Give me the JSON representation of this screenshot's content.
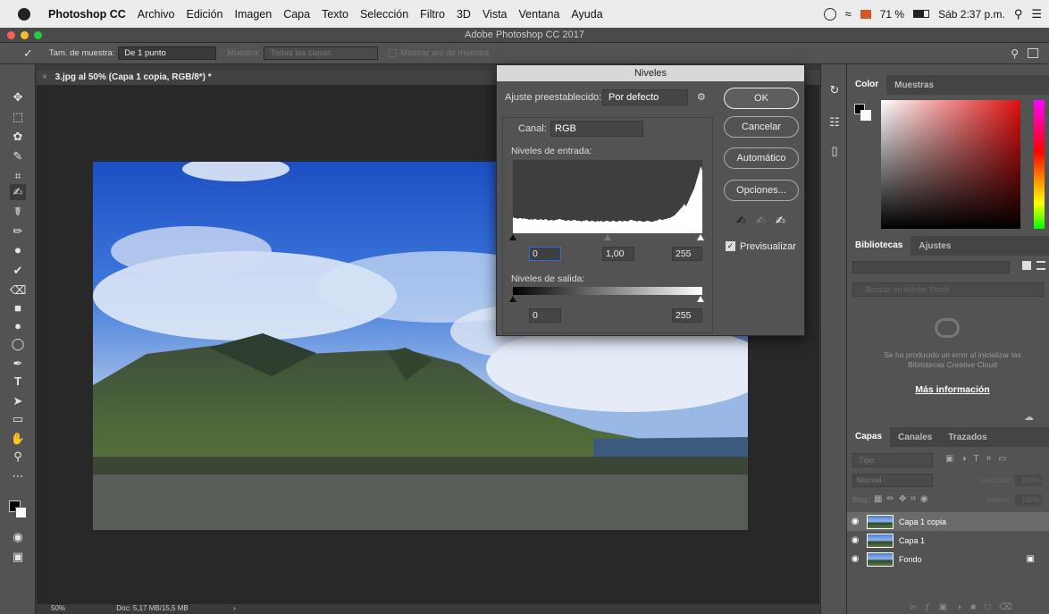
{
  "menubar": {
    "app": "Photoshop CC",
    "items": [
      "Archivo",
      "Edición",
      "Imagen",
      "Capa",
      "Texto",
      "Selección",
      "Filtro",
      "3D",
      "Vista",
      "Ventana",
      "Ayuda"
    ],
    "battery": "71 %",
    "clock": "Sáb 2:37 p.m."
  },
  "window": {
    "title": "Adobe Photoshop CC 2017"
  },
  "options": {
    "sample_label": "Tam. de muestra:",
    "sample_value": "De 1 punto",
    "muestra_label": "Muestra:",
    "muestra_value": "Todas las capas",
    "ring_label": "Mostrar aro de muestra"
  },
  "document": {
    "tab": "3.jpg al 50% (Capa 1 copia, RGB/8*) *",
    "zoom": "50%",
    "doc_info": "Doc: 5,17 MB/15,5 MB"
  },
  "niveles": {
    "title": "Niveles",
    "preset_label": "Ajuste preestablecido:",
    "preset_value": "Por defecto",
    "channel_label": "Canal:",
    "channel_value": "RGB",
    "input_label": "Niveles de entrada:",
    "input_values": [
      "0",
      "1,00",
      "255"
    ],
    "output_label": "Niveles de salida:",
    "output_values": [
      "0",
      "255"
    ],
    "buttons": {
      "ok": "OK",
      "cancel": "Cancelar",
      "auto": "Automático",
      "options": "Opciones..."
    },
    "preview_label": "Previsualizar",
    "preview_checked": true
  },
  "color_panel": {
    "tabs": [
      "Color",
      "Muestras"
    ]
  },
  "libraries_panel": {
    "tabs": [
      "Bibliotecas",
      "Ajustes"
    ],
    "search_placeholder": "Buscar en Adobe Stock",
    "error": "Se ha producido un error al inicializar las Bibliotecas Creative Cloud",
    "link": "Más información"
  },
  "layers_panel": {
    "tabs": [
      "Capas",
      "Canales",
      "Trazados"
    ],
    "filter": "Tipo",
    "blend": "Normal",
    "opacity_label": "Opacidad:",
    "opacity": "100%",
    "lock_label": "Bloq.:",
    "fill_label": "Relleno:",
    "fill": "100%",
    "layers": [
      {
        "name": "Capa 1 copia",
        "selected": true,
        "locked": false
      },
      {
        "name": "Capa 1",
        "selected": false,
        "locked": false
      },
      {
        "name": "Fondo",
        "selected": false,
        "locked": true
      }
    ]
  },
  "histogram": [
    18,
    17,
    17,
    16,
    17,
    17,
    16,
    17,
    16,
    16,
    15,
    16,
    15,
    16,
    16,
    15,
    15,
    16,
    15,
    15,
    16,
    15,
    14,
    15,
    15,
    14,
    15,
    15,
    16,
    16,
    15,
    15,
    14,
    14,
    15,
    14,
    14,
    15,
    15,
    14,
    14,
    14,
    13,
    14,
    14,
    15,
    14,
    13,
    14,
    14,
    13,
    13,
    14,
    13,
    14,
    13,
    13,
    14,
    14,
    13,
    13,
    14,
    14,
    13,
    13,
    14,
    14,
    13,
    14,
    14,
    13,
    14,
    15,
    15,
    14,
    14,
    13,
    14,
    14,
    13,
    13,
    13,
    14,
    14,
    13,
    13,
    13,
    14,
    14,
    15,
    16,
    15,
    15,
    16,
    16,
    17,
    17,
    18,
    19,
    20,
    22,
    24,
    26,
    28,
    30,
    33,
    30,
    34,
    38,
    42,
    46,
    50,
    56,
    62,
    68,
    75,
    70
  ],
  "colors": {
    "accent": "#2a6fdb",
    "panel": "#535353",
    "dark": "#282828"
  }
}
